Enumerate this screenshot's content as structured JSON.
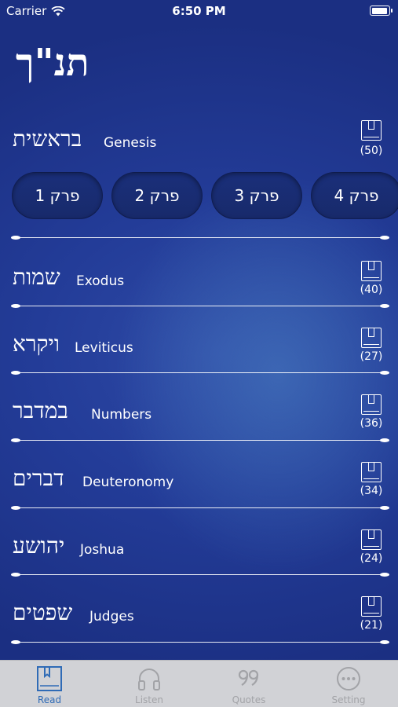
{
  "status_bar": {
    "carrier": "Carrier",
    "time": "6:50 PM"
  },
  "app_title": "תנ\"ך",
  "books": [
    {
      "hebrew": "בראשית",
      "english": "Genesis",
      "count": "(50)"
    },
    {
      "hebrew": "שמות",
      "english": "Exodus",
      "count": "(40)"
    },
    {
      "hebrew": "ויקרא",
      "english": "Leviticus",
      "count": "(27)"
    },
    {
      "hebrew": "במדבר",
      "english": "Numbers",
      "count": "(36)"
    },
    {
      "hebrew": "דברים",
      "english": "Deuteronomy",
      "count": "(34)"
    },
    {
      "hebrew": "יהושע",
      "english": "Joshua",
      "count": "(24)"
    },
    {
      "hebrew": "שפטים",
      "english": "Judges",
      "count": "(21)"
    }
  ],
  "chapters": [
    "פרק 1",
    "פרק 2",
    "פרק 3",
    "פרק 4"
  ],
  "tabs": [
    {
      "label": "Read",
      "icon": "book-icon",
      "active": true
    },
    {
      "label": "Listen",
      "icon": "headphones-icon",
      "active": false
    },
    {
      "label": "Quotes",
      "icon": "quote-icon",
      "active": false
    },
    {
      "label": "Setting",
      "icon": "more-icon",
      "active": false
    }
  ],
  "colors": {
    "accent": "#2f6bb6",
    "background": "#233c98",
    "tab_bar": "#d1d2d6",
    "tab_inactive": "#a2a3a7"
  }
}
